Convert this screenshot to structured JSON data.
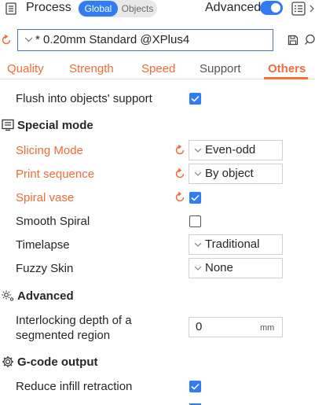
{
  "header": {
    "title": "Process",
    "mode_global": "Global",
    "mode_objects": "Objects",
    "advanced_label": "Advanced",
    "advanced_on": true
  },
  "preset": {
    "name": "* 0.20mm Standard @XPlus4"
  },
  "tabs": [
    {
      "label": "Quality"
    },
    {
      "label": "Strength"
    },
    {
      "label": "Speed"
    },
    {
      "label": "Support"
    },
    {
      "label": "Others",
      "active": true
    }
  ],
  "settings": {
    "flush_support": {
      "label": "Flush into objects' support",
      "checked": true
    },
    "special_mode": {
      "title": "Special mode",
      "slicing_mode": {
        "label": "Slicing Mode",
        "value": "Even-odd"
      },
      "print_sequence": {
        "label": "Print sequence",
        "value": "By object"
      },
      "spiral_vase": {
        "label": "Spiral vase",
        "checked": true
      },
      "smooth_spiral": {
        "label": "Smooth Spiral",
        "checked": false
      },
      "timelapse": {
        "label": "Timelapse",
        "value": "Traditional"
      },
      "fuzzy_skin": {
        "label": "Fuzzy Skin",
        "value": "None"
      }
    },
    "advanced": {
      "title": "Advanced",
      "interlocking_line1": "Interlocking depth of a",
      "interlocking_line2": "segmented region",
      "interlocking_value": "0",
      "interlocking_unit": "mm"
    },
    "gcode": {
      "title": "G-code output",
      "reduce_infill_retraction": {
        "label": "Reduce infill retraction",
        "checked": true
      }
    }
  },
  "colors": {
    "accent": "#2f7cf6",
    "modified": "#f26b3a",
    "tab_active": "#ff6f2c"
  }
}
